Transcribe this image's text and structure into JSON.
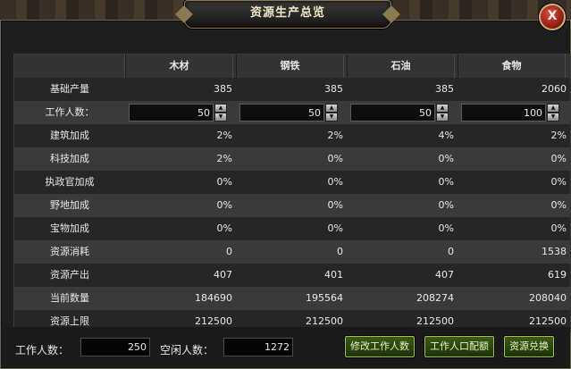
{
  "window": {
    "title": "资源生产总览",
    "close_label": "X"
  },
  "table": {
    "columns": [
      "木材",
      "钢铁",
      "石油",
      "食物"
    ],
    "rows": [
      {
        "label": "基础产量",
        "values": [
          "385",
          "385",
          "385",
          "2060"
        ]
      },
      {
        "label": "工作人数：",
        "values": [
          "50",
          "50",
          "50",
          "100"
        ],
        "editable": true
      },
      {
        "label": "建筑加成",
        "values": [
          "2%",
          "2%",
          "4%",
          "2%"
        ]
      },
      {
        "label": "科技加成",
        "values": [
          "2%",
          "0%",
          "0%",
          "0%"
        ]
      },
      {
        "label": "执政官加成",
        "values": [
          "0%",
          "0%",
          "0%",
          "0%"
        ]
      },
      {
        "label": "野地加成",
        "values": [
          "0%",
          "0%",
          "0%",
          "0%"
        ]
      },
      {
        "label": "宝物加成",
        "values": [
          "0%",
          "0%",
          "0%",
          "0%"
        ]
      },
      {
        "label": "资源消耗",
        "values": [
          "0",
          "0",
          "0",
          "1538"
        ]
      },
      {
        "label": "资源产出",
        "values": [
          "407",
          "401",
          "407",
          "619"
        ]
      },
      {
        "label": "当前数量",
        "values": [
          "184690",
          "195564",
          "208274",
          "208040"
        ]
      },
      {
        "label": "资源上限",
        "values": [
          "212500",
          "212500",
          "212500",
          "212500"
        ]
      }
    ]
  },
  "footer": {
    "workers_label": "工作人数：",
    "workers_value": "250",
    "idle_label": "空闲人数：",
    "idle_value": "1272",
    "buttons": [
      "修改工作人数",
      "工作人口配额",
      "资源兑换"
    ]
  },
  "icons": {
    "spin_up": "up-arrow-icon",
    "spin_down": "down-arrow-icon"
  }
}
